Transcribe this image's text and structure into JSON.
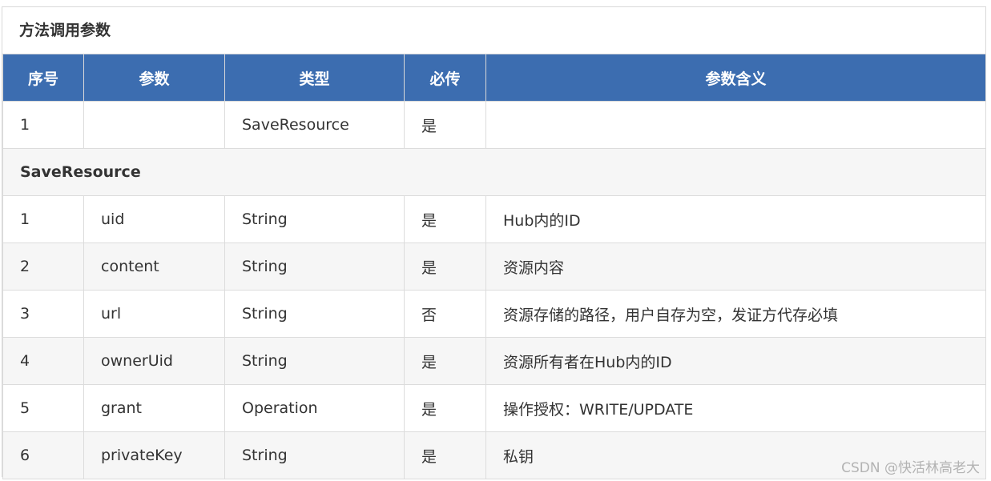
{
  "caption": "方法调用参数",
  "headers": [
    "序号",
    "参数",
    "类型",
    "必传",
    "参数含义"
  ],
  "top_row": {
    "no": "1",
    "param": "",
    "type": "SaveResource",
    "required": "是",
    "desc": ""
  },
  "group_label": "SaveResource",
  "rows": [
    {
      "no": "1",
      "param": "uid",
      "type": "String",
      "required": "是",
      "desc": "Hub内的ID"
    },
    {
      "no": "2",
      "param": "content",
      "type": "String",
      "required": "是",
      "desc": "资源内容"
    },
    {
      "no": "3",
      "param": "url",
      "type": "String",
      "required": "否",
      "desc": "资源存储的路径，用户自存为空，发证方代存必填"
    },
    {
      "no": "4",
      "param": "ownerUid",
      "type": "String",
      "required": "是",
      "desc": "资源所有者在Hub内的ID"
    },
    {
      "no": "5",
      "param": "grant",
      "type": "Operation",
      "required": "是",
      "desc": "操作授权：WRITE/UPDATE"
    },
    {
      "no": "6",
      "param": "privateKey",
      "type": "String",
      "required": "是",
      "desc": "私钥"
    }
  ],
  "watermark": "CSDN @快活林高老大",
  "colors": {
    "header_bg": "#3c6db0",
    "row_alt_bg": "#f6f6f6",
    "border": "#dcdcdc"
  }
}
